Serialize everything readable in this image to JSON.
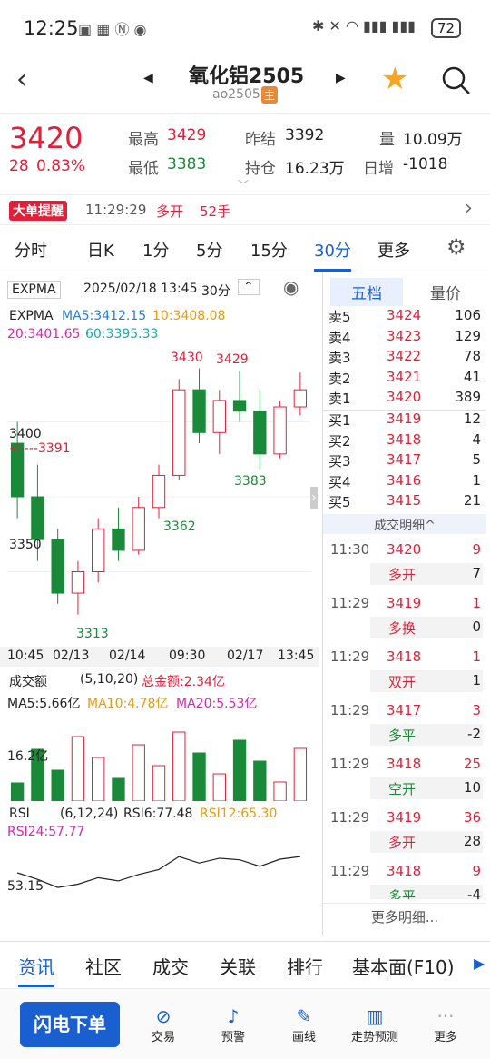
{
  "status": {
    "time": "12:25",
    "battery": "72"
  },
  "header": {
    "title": "氧化铝2505",
    "code": "ao2505",
    "main_badge": "主"
  },
  "quote": {
    "price": "3420",
    "change": "28",
    "change_pct": "0.83%",
    "high_label": "最高",
    "high": "3429",
    "low_label": "最低",
    "low": "3383",
    "prev_label": "昨结",
    "prev": "3392",
    "oi_label": "持仓",
    "oi": "16.23万",
    "vol_label": "量",
    "vol": "10.09万",
    "inc_label": "日增",
    "inc": "-1018"
  },
  "alert": {
    "tag": "大单提醒",
    "time": "11:29:29",
    "action": "多开",
    "qty": "52手"
  },
  "periods": [
    "分时",
    "日K",
    "1分",
    "5分",
    "15分",
    "30分",
    "更多"
  ],
  "active_period": "30分",
  "chart_toolbar": {
    "indicator": "EXPMA",
    "datetime": "2025/02/18 13:45",
    "period": "30分"
  },
  "expma": {
    "label": "EXPMA",
    "ma5": "MA5:3412.15",
    "ma10": "10:3408.08",
    "ma20": "20:3401.65",
    "ma60": "60:3395.33"
  },
  "price_labels": {
    "p3430": "3430",
    "p3429": "3429",
    "p3400": "3400",
    "p3391": "<----3391",
    "p3383": "3383",
    "p3362": "3362",
    "p3350": "3350",
    "p3313": "3313"
  },
  "xaxis": [
    "10:45",
    "02/13",
    "02/14",
    "09:30",
    "02/17",
    "13:45"
  ],
  "volume": {
    "label": "成交额",
    "params": "(5,10,20)",
    "total": "总金额:2.34亿",
    "ma5": "MA5:5.66亿",
    "ma10": "MA10:4.78亿",
    "ma20": "MA20:5.53亿",
    "level": "16.2亿"
  },
  "rsi": {
    "label": "RSI",
    "params": "(6,12,24)",
    "rsi6": "RSI6:77.48",
    "rsi12": "RSI12:65.30",
    "rsi24": "RSI24:57.77",
    "level": "53.15"
  },
  "order_book": {
    "tab_active": "五档",
    "tab2": "量价",
    "asks": [
      {
        "l": "卖5",
        "p": "3424",
        "v": "106"
      },
      {
        "l": "卖4",
        "p": "3423",
        "v": "129"
      },
      {
        "l": "卖3",
        "p": "3422",
        "v": "78"
      },
      {
        "l": "卖2",
        "p": "3421",
        "v": "41"
      },
      {
        "l": "卖1",
        "p": "3420",
        "v": "389"
      }
    ],
    "bids": [
      {
        "l": "买1",
        "p": "3419",
        "v": "12"
      },
      {
        "l": "买2",
        "p": "3418",
        "v": "4"
      },
      {
        "l": "买3",
        "p": "3417",
        "v": "5"
      },
      {
        "l": "买4",
        "p": "3416",
        "v": "1"
      },
      {
        "l": "买5",
        "p": "3415",
        "v": "21"
      }
    ]
  },
  "trades": {
    "header": "成交明细^",
    "more": "更多明细...",
    "rows": [
      {
        "t": "11:30",
        "p": "3420",
        "v": "9",
        "type": "多开",
        "oi": "7",
        "pc": "red",
        "tc": "red"
      },
      {
        "t": "11:29",
        "p": "3419",
        "v": "1",
        "type": "多换",
        "oi": "0",
        "pc": "red",
        "tc": "red"
      },
      {
        "t": "11:29",
        "p": "3418",
        "v": "1",
        "type": "双开",
        "oi": "1",
        "pc": "red",
        "tc": "red"
      },
      {
        "t": "11:29",
        "p": "3417",
        "v": "3",
        "type": "多平",
        "oi": "-2",
        "pc": "red",
        "tc": "green"
      },
      {
        "t": "11:29",
        "p": "3418",
        "v": "25",
        "type": "空开",
        "oi": "10",
        "pc": "red",
        "tc": "green"
      },
      {
        "t": "11:29",
        "p": "3419",
        "v": "36",
        "type": "多开",
        "oi": "28",
        "pc": "red",
        "tc": "red"
      },
      {
        "t": "11:29",
        "p": "3418",
        "v": "9",
        "type": "多平",
        "oi": "-4",
        "pc": "red",
        "tc": "green"
      }
    ]
  },
  "bottom_tabs": [
    "资讯",
    "社区",
    "成交",
    "关联",
    "排行",
    "基本面(F10)"
  ],
  "actions": {
    "flash": "闪电下单",
    "items": [
      "交易",
      "预警",
      "画线",
      "走势预测",
      "更多"
    ]
  },
  "chart_data": {
    "type": "candlestick",
    "ylim": [
      3300,
      3440
    ],
    "candles": [
      [
        3395,
        3405,
        3360,
        3370
      ],
      [
        3370,
        3385,
        3340,
        3350
      ],
      [
        3350,
        3355,
        3320,
        3325
      ],
      [
        3325,
        3340,
        3315,
        3335
      ],
      [
        3335,
        3360,
        3330,
        3355
      ],
      [
        3355,
        3365,
        3340,
        3345
      ],
      [
        3345,
        3370,
        3343,
        3365
      ],
      [
        3365,
        3385,
        3360,
        3380
      ],
      [
        3380,
        3425,
        3378,
        3420
      ],
      [
        3420,
        3430,
        3395,
        3400
      ],
      [
        3400,
        3420,
        3390,
        3415
      ],
      [
        3415,
        3429,
        3405,
        3410
      ],
      [
        3410,
        3420,
        3383,
        3390
      ],
      [
        3390,
        3415,
        3388,
        3412
      ],
      [
        3412,
        3428,
        3408,
        3420
      ]
    ]
  }
}
